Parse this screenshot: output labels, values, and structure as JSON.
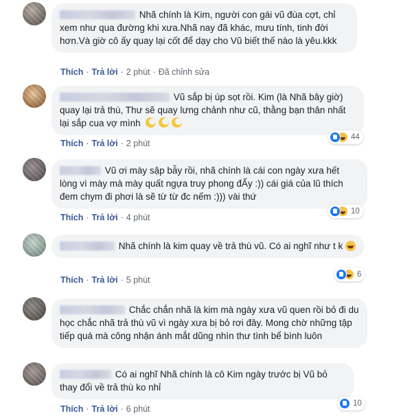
{
  "comments": [
    {
      "text": "Nhã chính là Kim, người con gái vũ đùa cợt, chỉ xem như qua đường khi xưa.Nhã nay đã khác, mưu tính, tinh đời hơn.Và giờ cô ấy quay lại cốt để dạy cho Vũ biết thế nào là yêu.kkk",
      "like": "Thích",
      "reply": "Trả lời",
      "time": "2 phút",
      "edited": "Đã chỉnh sửa"
    },
    {
      "text": "Vũ sắp bị úp sọt rồi. Kim (là Nhã bây giờ) quay lại trả thù, Thư sẽ quay lưng chảnh như cũ, thằng bạn thân nhất lại sắp cua vợ mình",
      "like": "Thích",
      "reply": "Trả lời",
      "time": "2 phút",
      "reaction_count": "44"
    },
    {
      "text": "Vũ ơi mày sập bẫy rồi, nhã chính là cái con ngày xưa hết lòng vì mày mà mày quất ngựa truy phong đẤy :)) cái giá của lũ thích đem chym đi phơi là sẽ từ từ đc nếm :))) vài thứ",
      "like": "Thích",
      "reply": "Trả lời",
      "time": "4 phút",
      "reaction_count": "10"
    },
    {
      "text": "Nhã chính là kim quay về trả thù vũ. Có ai nghĩ như t k",
      "like": "Thích",
      "reply": "Trả lời",
      "time": "5 phút",
      "reaction_count": "6"
    },
    {
      "text": "Chắc chắn nhã là kim mà ngày xưa vũ quen rồi bỏ đi du học chắc nhã trả thù vũ vì ngày xưa bị bỏ rơi đây. Mong chờ những tập tiếp quá mà công nhận ánh mắt dũng nhìn thư tình bể bình luôn",
      "like": "Thích",
      "reply": "Trả lời",
      "time": "6 phút"
    },
    {
      "text": "Có ai nghĩ Nhã chính là cô Kim ngày trước bị Vũ bỏ thay đổi về trả thù ko nhỉ",
      "like": "Thích",
      "reply": "Trả lời",
      "time": "6 phút",
      "reaction_count": "10"
    }
  ],
  "colors": {
    "bubble": "#f2f3f5",
    "link": "#385898",
    "muted": "#606770",
    "like": "#1877f2",
    "haha": "#f7c04a"
  }
}
